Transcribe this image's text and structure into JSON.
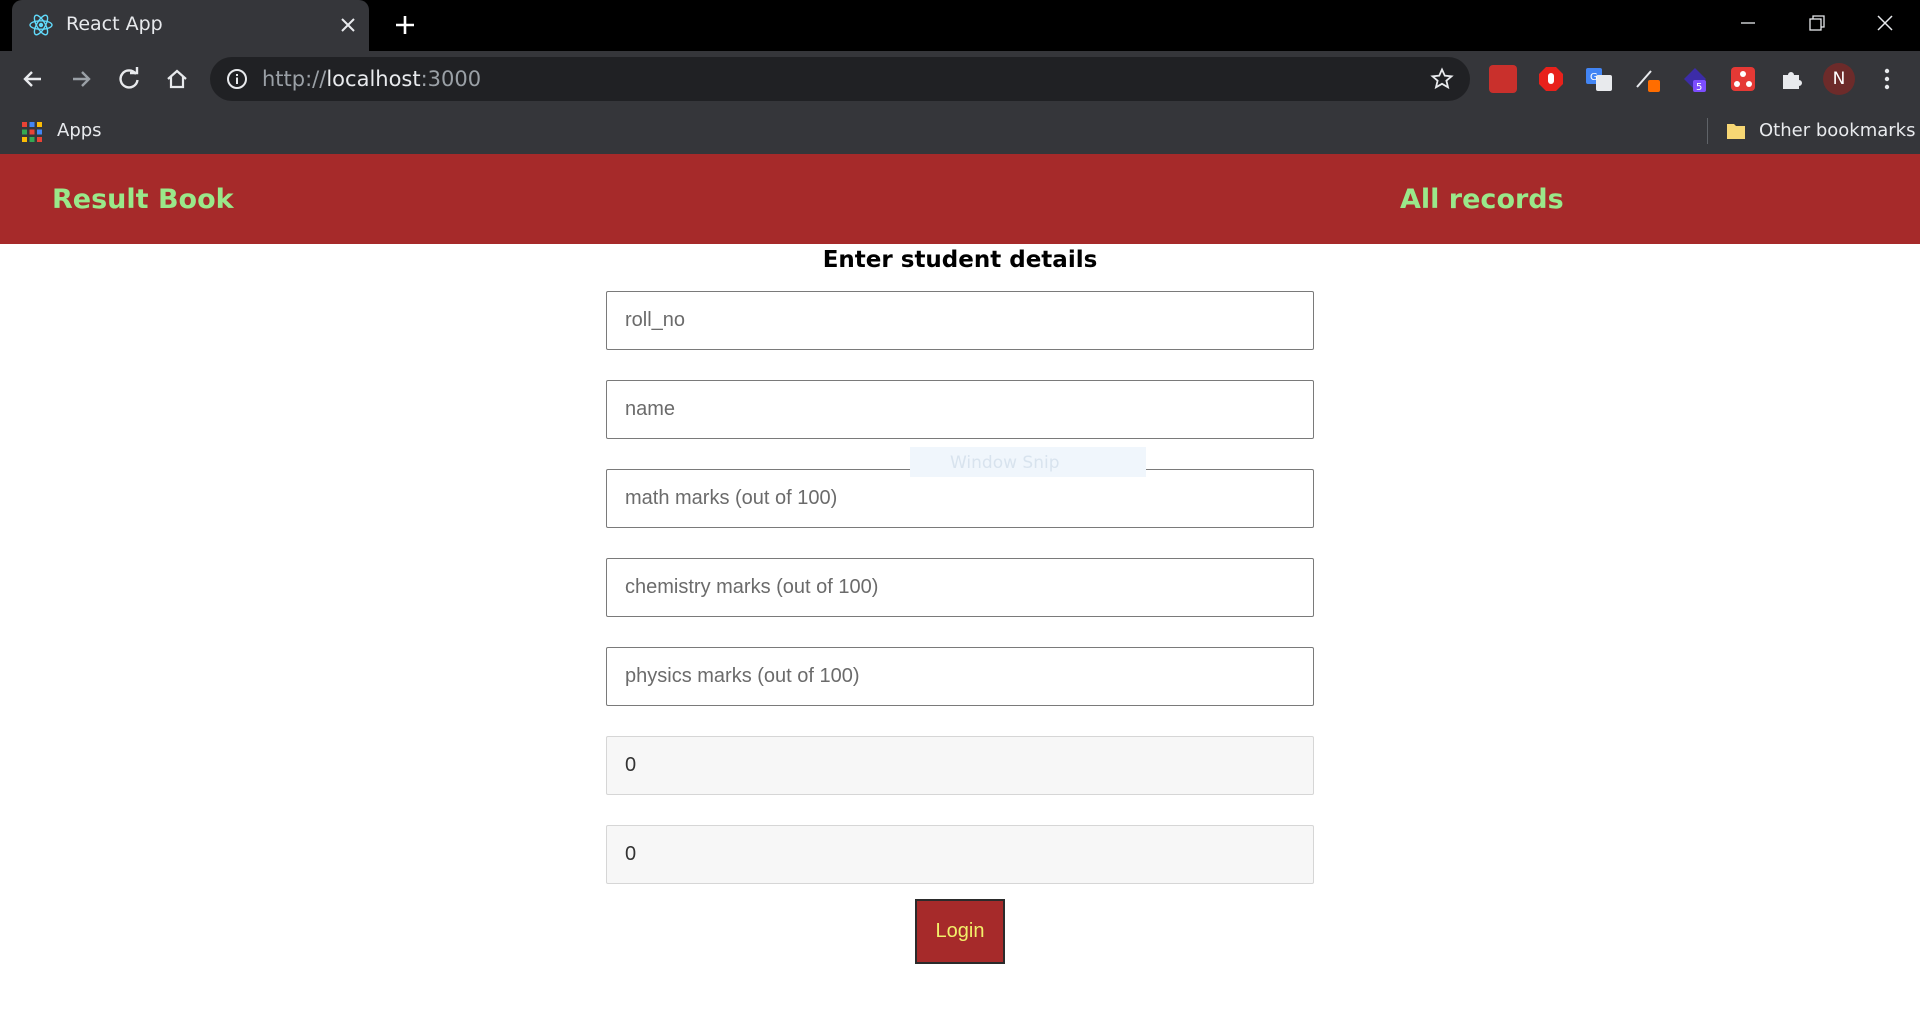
{
  "browser": {
    "tab_title": "React App",
    "url_scheme": "http://",
    "url_host": "localhost",
    "url_port": ":3000",
    "bookmarks": {
      "apps_label": "Apps",
      "other_label": "Other bookmarks"
    },
    "profile_initial": "N",
    "extension_badge": "5"
  },
  "header": {
    "brand": "Result Book",
    "nav_all_records": "All records"
  },
  "form": {
    "title": "Enter student details",
    "fields": [
      {
        "placeholder": "roll_no"
      },
      {
        "placeholder": "name"
      },
      {
        "placeholder": "math marks (out of 100)"
      },
      {
        "placeholder": "chemistry marks (out of 100)"
      },
      {
        "placeholder": "physics marks (out of 100)"
      }
    ],
    "computed": [
      {
        "value": "0"
      },
      {
        "value": "0"
      }
    ],
    "submit_label": "Login"
  },
  "overlay": {
    "snip_label": "Window Snip"
  },
  "colors": {
    "header_bg": "#a62a2a",
    "header_text": "#9ae88a",
    "button_text": "#f2f06a"
  }
}
